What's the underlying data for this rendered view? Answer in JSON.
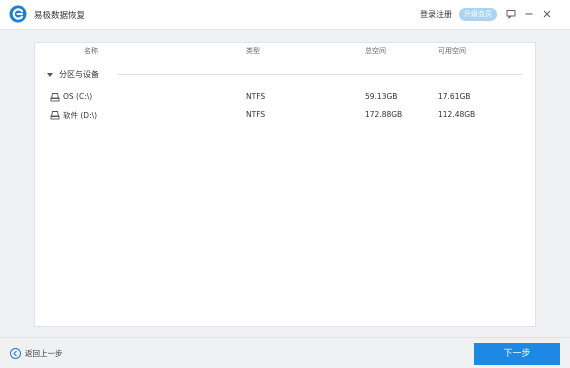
{
  "app": {
    "title": "易极数据恢复"
  },
  "header": {
    "login_label": "登录注册",
    "upgrade_label": "升级会员"
  },
  "colors": {
    "accent": "#1e88e5",
    "upgrade_bg": "#a9d4f4",
    "logo": "#1a7fd6"
  },
  "icons": {
    "logo": "app-logo-icon",
    "feedback": "feedback-icon",
    "minimize": "minimize-icon",
    "close": "close-icon",
    "disk": "disk-icon",
    "back": "back-arrow-icon"
  },
  "table": {
    "columns": {
      "name": "名称",
      "type": "类型",
      "total": "总空间",
      "free": "可用空间"
    },
    "group_label": "分区与设备",
    "rows": [
      {
        "name": "OS  (C:\\)",
        "type": "NTFS",
        "total": "59.13GB",
        "free": "17.61GB"
      },
      {
        "name": "软件  (D:\\)",
        "type": "NTFS",
        "total": "172.88GB",
        "free": "112.48GB"
      }
    ]
  },
  "footer": {
    "back_label": "返回上一步",
    "next_label": "下一步"
  }
}
